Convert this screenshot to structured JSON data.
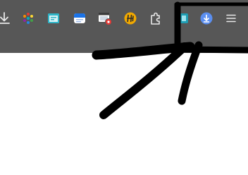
{
  "browser_toolbar": {
    "buttons": [
      {
        "name": "downloads-button",
        "icon": "download-arrow-icon"
      },
      {
        "name": "extension-colorful-button",
        "icon": "colorful-dots-icon"
      },
      {
        "name": "extension-teal-button",
        "icon": "teal-window-icon"
      },
      {
        "name": "extension-calendar-button",
        "icon": "blue-window-icon"
      },
      {
        "name": "extension-recorder-button",
        "icon": "window-record-icon"
      },
      {
        "name": "extension-honey-button",
        "icon": "orange-h-badge-icon"
      },
      {
        "name": "extensions-button",
        "icon": "puzzle-piece-icon"
      },
      {
        "name": "extension-teal-square-button",
        "icon": "teal-square-icon"
      },
      {
        "name": "download-manager-button",
        "icon": "blue-circle-download-icon"
      },
      {
        "name": "browser-menu-button",
        "icon": "hamburger-menu-icon"
      }
    ]
  },
  "colors": {
    "toolbar_bg": "#575757",
    "icon_light": "#e8e8e8",
    "annotation": "#000000",
    "download_badge": "#5b8ff0",
    "honey_badge": "#f2a900"
  },
  "annotation": {
    "type": "hand-drawn-arrow",
    "points_to": "download-manager-button"
  }
}
